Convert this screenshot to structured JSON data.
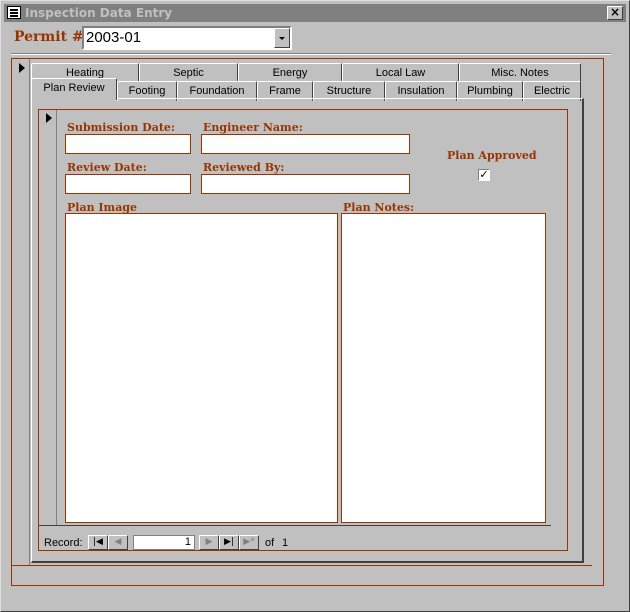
{
  "window": {
    "title": "Inspection Data Entry",
    "close_label": "×"
  },
  "permit": {
    "label": "Permit #:",
    "value": "2003-01"
  },
  "tabs_row1": [
    {
      "label": "Heating"
    },
    {
      "label": "Septic"
    },
    {
      "label": "Energy"
    },
    {
      "label": "Local Law"
    },
    {
      "label": "Misc. Notes"
    }
  ],
  "tabs_row2": [
    {
      "label": "Plan Review"
    },
    {
      "label": "Footing"
    },
    {
      "label": "Foundation"
    },
    {
      "label": "Frame"
    },
    {
      "label": "Structure"
    },
    {
      "label": "Insulation"
    },
    {
      "label": "Plumbing"
    },
    {
      "label": "Electric"
    }
  ],
  "active_tab": "Plan Review",
  "form": {
    "submission_date_label": "Submission Date:",
    "engineer_name_label": "Engineer Name:",
    "review_date_label": "Review Date:",
    "reviewed_by_label": "Reviewed By:",
    "plan_approved_label": "Plan Approved",
    "plan_approved_checked": true,
    "plan_approved_mark": "✓",
    "plan_image_label": "Plan Image",
    "plan_notes_label": "Plan Notes:"
  },
  "navigator": {
    "record_label": "Record:",
    "current_record": "1",
    "of_label": "of",
    "total_records": "1",
    "first_icon": "first-record-icon",
    "prev_icon": "prev-record-icon",
    "next_icon": "next-record-icon",
    "last_icon": "last-record-icon",
    "new_icon": "new-record-icon"
  },
  "colors": {
    "label_brown": "#993300",
    "face": "#c0c0c0",
    "titlebar_inactive": "#808080"
  }
}
